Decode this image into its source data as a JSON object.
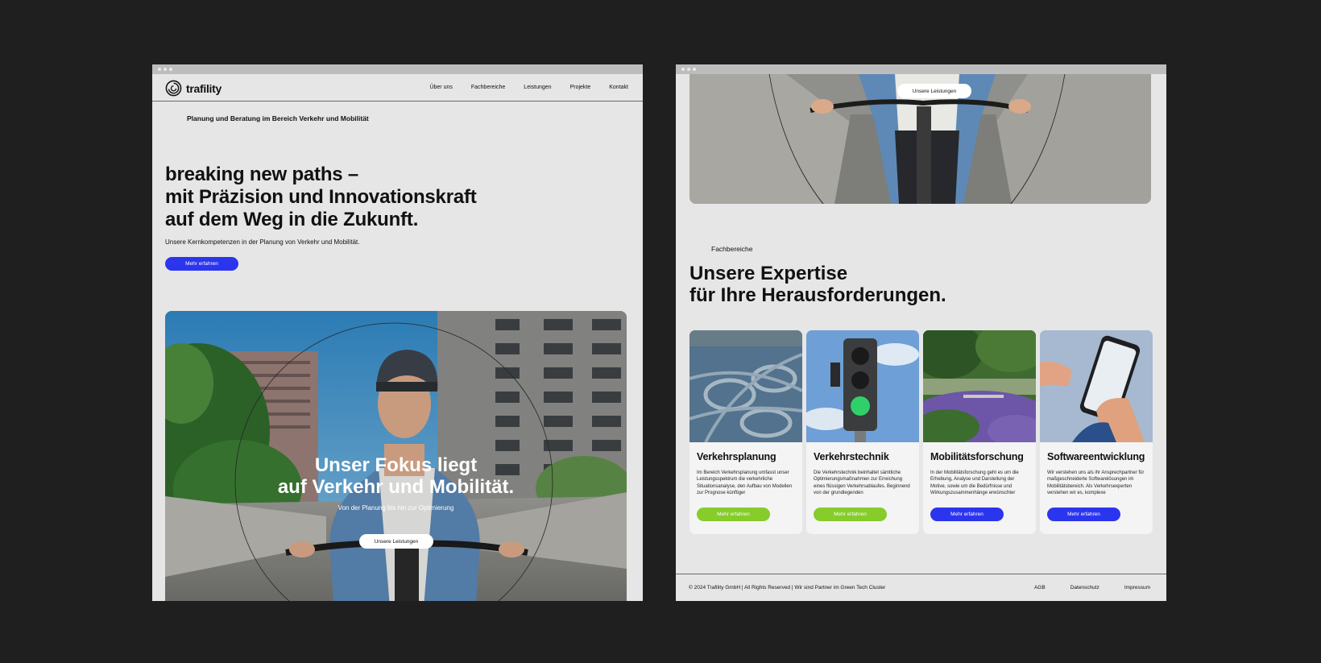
{
  "left": {
    "logo": {
      "text": "trafility"
    },
    "nav": [
      "Über uns",
      "Fachbereiche",
      "Leistungen",
      "Projekte",
      "Kontakt"
    ],
    "tagline": "Planung und Beratung im Bereich Verkehr und Mobilität",
    "headline": {
      "bold": "breaking new paths –",
      "line2": "mit Präzision und Innovationskraft",
      "line3": "auf dem Weg in die Zukunft."
    },
    "subline": "Unsere Kernkompetenzen in der Planung von Verkehr und Mobilität.",
    "cta": "Mehr erfahren",
    "hero": {
      "title_line1": "Unser Fokus liegt",
      "title_line2": "auf Verkehr und Mobilität.",
      "subtitle": "Von der Planung bis hin zur Optimierung",
      "cta": "Unsere Leistungen"
    }
  },
  "right": {
    "top_cta": "Unsere Leistungen",
    "section_label": "Fachbereiche",
    "section_title": {
      "line1": "Unsere Expertise",
      "line2": "für Ihre Herausforderungen."
    },
    "cards": [
      {
        "title": "Verkehrsplanung",
        "text": "Im Bereich Verkehrsplanung umfasst unser Leistungsspektrum die verkehrliche Situationsanalyse, den Aufbau von Modellen zur Prognose künftiger",
        "cta": "Mehr erfahren",
        "cta_color": "green",
        "image_icon": "highway-interchange-image"
      },
      {
        "title": "Verkehrstechnik",
        "text": "Die Verkehrstechnik beinhaltet sämtliche Optimierungsmaßnahmen zur Erreichung eines flüssigen Verkehrsablaufes. Beginnend von der grundlegenden",
        "cta": "Mehr erfahren",
        "cta_color": "green",
        "image_icon": "traffic-light-image"
      },
      {
        "title": "Mobilitätsforschung",
        "text": "In der Mobilitätsforschung geht es um die Erhebung, Analyse und Darstellung der Motive, sowie um die Bedürfnisse und Wirkungszusammenhänge erwünschter",
        "cta": "Mehr erfahren",
        "cta_color": "blue",
        "image_icon": "park-image"
      },
      {
        "title": "Softwareentwicklung",
        "text": "Wir verstehen uns als ihr Ansprechpartner für maßgeschneiderte Softwarelösungen im Mobilitätsbereich. Als Verkehrsexperten verstehen wir es, komplexe",
        "cta": "Mehr erfahren",
        "cta_color": "blue",
        "image_icon": "smartphone-image"
      }
    ],
    "footer": {
      "copyright": "© 2024 Trafility GmbH | All Rights Reserved | Wir sind Partner im Green Tech Cluster",
      "links": [
        "AGB",
        "Datenschutz",
        "Impressum"
      ]
    }
  },
  "colors": {
    "blue": "#2c35ee",
    "green": "#86cc2a",
    "background": "#1f1f1f",
    "page": "#e6e6e6"
  }
}
